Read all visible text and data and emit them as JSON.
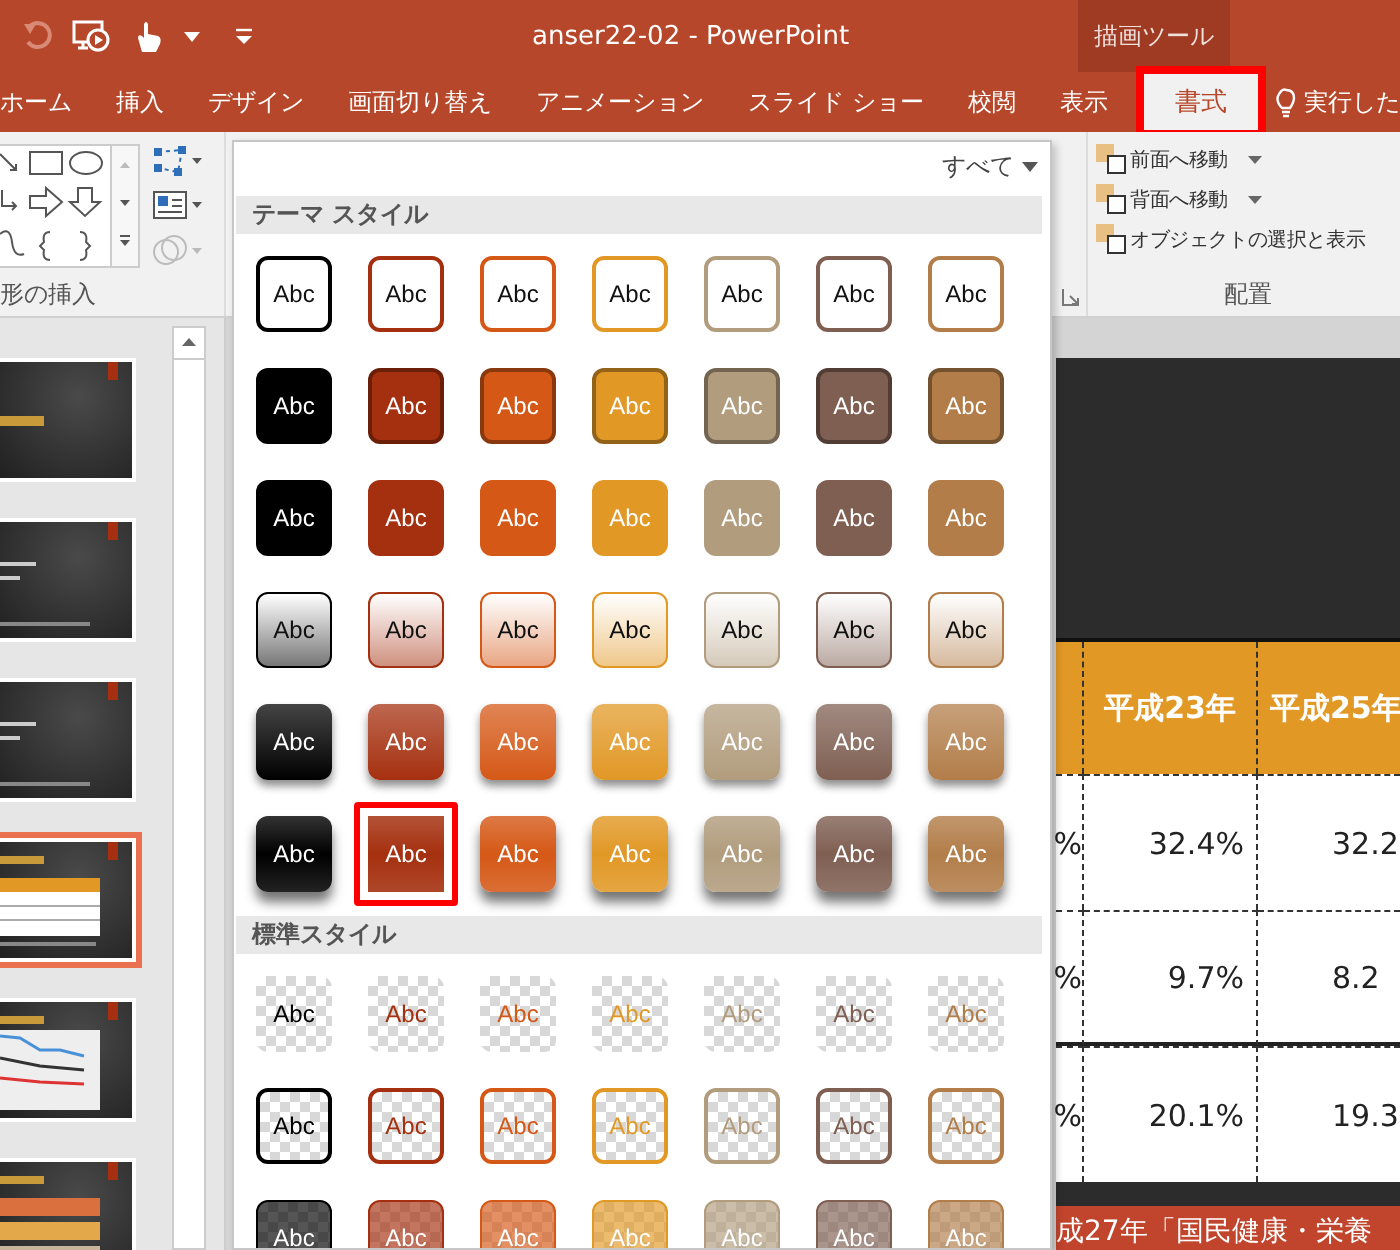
{
  "window": {
    "title": "anser22-02  -  PowerPoint",
    "context_group": "描画ツール"
  },
  "tabs": [
    {
      "label": "ホーム",
      "selected": false
    },
    {
      "label": "挿入",
      "selected": false
    },
    {
      "label": "デザイン",
      "selected": false
    },
    {
      "label": "画面切り替え",
      "selected": false
    },
    {
      "label": "アニメーション",
      "selected": false
    },
    {
      "label": "スライド ショー",
      "selected": false
    },
    {
      "label": "校閲",
      "selected": false
    },
    {
      "label": "表示",
      "selected": false
    },
    {
      "label": "書式",
      "selected": true
    }
  ],
  "tell_me": "実行した",
  "ribbon": {
    "shapes_group_label": "形の挿入",
    "arrange_items": [
      {
        "label": "前面へ移動",
        "dropdown": true
      },
      {
        "label": "背面へ移動",
        "dropdown": true
      },
      {
        "label": "オブジェクトの選択と表示",
        "dropdown": false
      }
    ],
    "arrange_label": "配置"
  },
  "thumbnails": [
    {
      "kind": "title",
      "selected": false
    },
    {
      "kind": "text",
      "selected": false
    },
    {
      "kind": "text",
      "selected": false
    },
    {
      "kind": "table",
      "selected": true
    },
    {
      "kind": "chart",
      "selected": false
    },
    {
      "kind": "list",
      "selected": false
    }
  ],
  "gallery": {
    "filter": "すべて",
    "sections": [
      {
        "title": "テーマ スタイル",
        "rows": [
          {
            "kind": "outline",
            "swatches": [
              {
                "label": "Abc",
                "color": "#000000",
                "selected": false
              },
              {
                "label": "Abc",
                "color": "#a5300f",
                "selected": false
              },
              {
                "label": "Abc",
                "color": "#d55816",
                "selected": false
              },
              {
                "label": "Abc",
                "color": "#e19825",
                "selected": false
              },
              {
                "label": "Abc",
                "color": "#b19c7d",
                "selected": false
              },
              {
                "label": "Abc",
                "color": "#7f5f52",
                "selected": false
              },
              {
                "label": "Abc",
                "color": "#b27d49",
                "selected": false
              }
            ]
          },
          {
            "kind": "fill",
            "swatches": [
              {
                "label": "Abc",
                "color": "#000000",
                "selected": false
              },
              {
                "label": "Abc",
                "color": "#a5300f",
                "selected": false
              },
              {
                "label": "Abc",
                "color": "#d55816",
                "selected": false
              },
              {
                "label": "Abc",
                "color": "#e19825",
                "selected": false
              },
              {
                "label": "Abc",
                "color": "#b19c7d",
                "selected": false
              },
              {
                "label": "Abc",
                "color": "#7f5f52",
                "selected": false
              },
              {
                "label": "Abc",
                "color": "#b27d49",
                "selected": false
              }
            ]
          },
          {
            "kind": "flat",
            "swatches": [
              {
                "label": "Abc",
                "color": "#000000",
                "selected": false
              },
              {
                "label": "Abc",
                "color": "#a5300f",
                "selected": false
              },
              {
                "label": "Abc",
                "color": "#d55816",
                "selected": false
              },
              {
                "label": "Abc",
                "color": "#e19825",
                "selected": false
              },
              {
                "label": "Abc",
                "color": "#b19c7d",
                "selected": false
              },
              {
                "label": "Abc",
                "color": "#7f5f52",
                "selected": false
              },
              {
                "label": "Abc",
                "color": "#b27d49",
                "selected": false
              }
            ]
          },
          {
            "kind": "light",
            "swatches": [
              {
                "label": "Abc",
                "color": "#000000",
                "selected": false
              },
              {
                "label": "Abc",
                "color": "#a5300f",
                "selected": false
              },
              {
                "label": "Abc",
                "color": "#d55816",
                "selected": false
              },
              {
                "label": "Abc",
                "color": "#e19825",
                "selected": false
              },
              {
                "label": "Abc",
                "color": "#b19c7d",
                "selected": false
              },
              {
                "label": "Abc",
                "color": "#7f5f52",
                "selected": false
              },
              {
                "label": "Abc",
                "color": "#b27d49",
                "selected": false
              }
            ]
          },
          {
            "kind": "moderate",
            "swatches": [
              {
                "label": "Abc",
                "color": "#000000",
                "selected": false
              },
              {
                "label": "Abc",
                "color": "#a5300f",
                "selected": false
              },
              {
                "label": "Abc",
                "color": "#d55816",
                "selected": false
              },
              {
                "label": "Abc",
                "color": "#e19825",
                "selected": false
              },
              {
                "label": "Abc",
                "color": "#b19c7d",
                "selected": false
              },
              {
                "label": "Abc",
                "color": "#7f5f52",
                "selected": false
              },
              {
                "label": "Abc",
                "color": "#b27d49",
                "selected": false
              }
            ]
          },
          {
            "kind": "intense",
            "swatches": [
              {
                "label": "Abc",
                "color": "#000000",
                "selected": false
              },
              {
                "label": "Abc",
                "color": "#a5300f",
                "selected": true
              },
              {
                "label": "Abc",
                "color": "#d55816",
                "selected": false
              },
              {
                "label": "Abc",
                "color": "#e19825",
                "selected": false
              },
              {
                "label": "Abc",
                "color": "#b19c7d",
                "selected": false
              },
              {
                "label": "Abc",
                "color": "#7f5f52",
                "selected": false
              },
              {
                "label": "Abc",
                "color": "#b27d49",
                "selected": false
              }
            ]
          }
        ]
      },
      {
        "title": "標準スタイル",
        "rows": [
          {
            "kind": "ghost",
            "swatches": [
              {
                "label": "Abc",
                "color": "#000000",
                "selected": false
              },
              {
                "label": "Abc",
                "color": "#a5300f",
                "selected": false
              },
              {
                "label": "Abc",
                "color": "#d55816",
                "selected": false
              },
              {
                "label": "Abc",
                "color": "#e19825",
                "selected": false
              },
              {
                "label": "Abc",
                "color": "#b19c7d",
                "selected": false
              },
              {
                "label": "Abc",
                "color": "#7f5f52",
                "selected": false
              },
              {
                "label": "Abc",
                "color": "#b27d49",
                "selected": false
              }
            ]
          },
          {
            "kind": "ghost-outline",
            "swatches": [
              {
                "label": "Abc",
                "color": "#000000",
                "selected": false
              },
              {
                "label": "Abc",
                "color": "#a5300f",
                "selected": false
              },
              {
                "label": "Abc",
                "color": "#d55816",
                "selected": false
              },
              {
                "label": "Abc",
                "color": "#e19825",
                "selected": false
              },
              {
                "label": "Abc",
                "color": "#b19c7d",
                "selected": false
              },
              {
                "label": "Abc",
                "color": "#7f5f52",
                "selected": false
              },
              {
                "label": "Abc",
                "color": "#b27d49",
                "selected": false
              }
            ]
          },
          {
            "kind": "ghost-fill",
            "swatches": [
              {
                "label": "Abc",
                "color": "#000000",
                "selected": false
              },
              {
                "label": "Abc",
                "color": "#a5300f",
                "selected": false
              },
              {
                "label": "Abc",
                "color": "#d55816",
                "selected": false
              },
              {
                "label": "Abc",
                "color": "#e19825",
                "selected": false
              },
              {
                "label": "Abc",
                "color": "#b19c7d",
                "selected": false
              },
              {
                "label": "Abc",
                "color": "#7f5f52",
                "selected": false
              },
              {
                "label": "Abc",
                "color": "#b27d49",
                "selected": false
              }
            ]
          }
        ]
      }
    ]
  },
  "slide": {
    "table": {
      "columns": [
        "",
        "平成23年",
        "平成25年"
      ],
      "rows": [
        [
          "%",
          "32.4%",
          "32.2"
        ],
        [
          "%",
          "9.7%",
          "8.2"
        ],
        [
          "%",
          "20.1%",
          "19.3"
        ]
      ]
    },
    "caption": "成27年「国民健康・栄養"
  }
}
